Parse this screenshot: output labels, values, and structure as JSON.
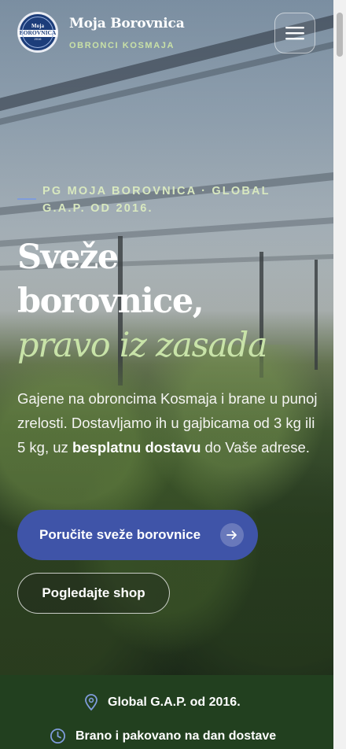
{
  "header": {
    "logo": {
      "line1": "Moja",
      "line2": "BOROVNICA",
      "line3": "2016"
    },
    "brand_title": "Moja Borovnica",
    "brand_subtitle": "OBRONCI KOSMAJA",
    "menu_icon": "hamburger-icon"
  },
  "hero": {
    "eyebrow": "PG MOJA BOROVNICA · GLOBAL G.A.P. OD 2016.",
    "headline_line1": "Sveže",
    "headline_line2": "borovnice,",
    "headline_line3": "pravo iz zasada",
    "lead_part1": "Gajene na obroncima Kosmaja i brane u punoj zrelosti. Dostavljamo ih u gajbicama od 3 kg ili 5 kg, uz ",
    "lead_bold1": "besplatnu dostavu",
    "lead_part2": " do Vaše adrese.",
    "cta_primary": "Poručite sveže borovnice",
    "cta_primary_icon": "arrow-right-icon",
    "cta_secondary": "Pogledajte shop"
  },
  "trust_bar": {
    "items": [
      {
        "icon": "location-pin-icon",
        "label": "Global G.A.P. od 2016."
      },
      {
        "icon": "clock-icon",
        "label": "Brano i pakovano na dan dostave"
      }
    ]
  },
  "colors": {
    "primary_button": "#3f54a8",
    "accent_green": "#c8e3a8",
    "trust_bar_bg": "#22401f"
  }
}
